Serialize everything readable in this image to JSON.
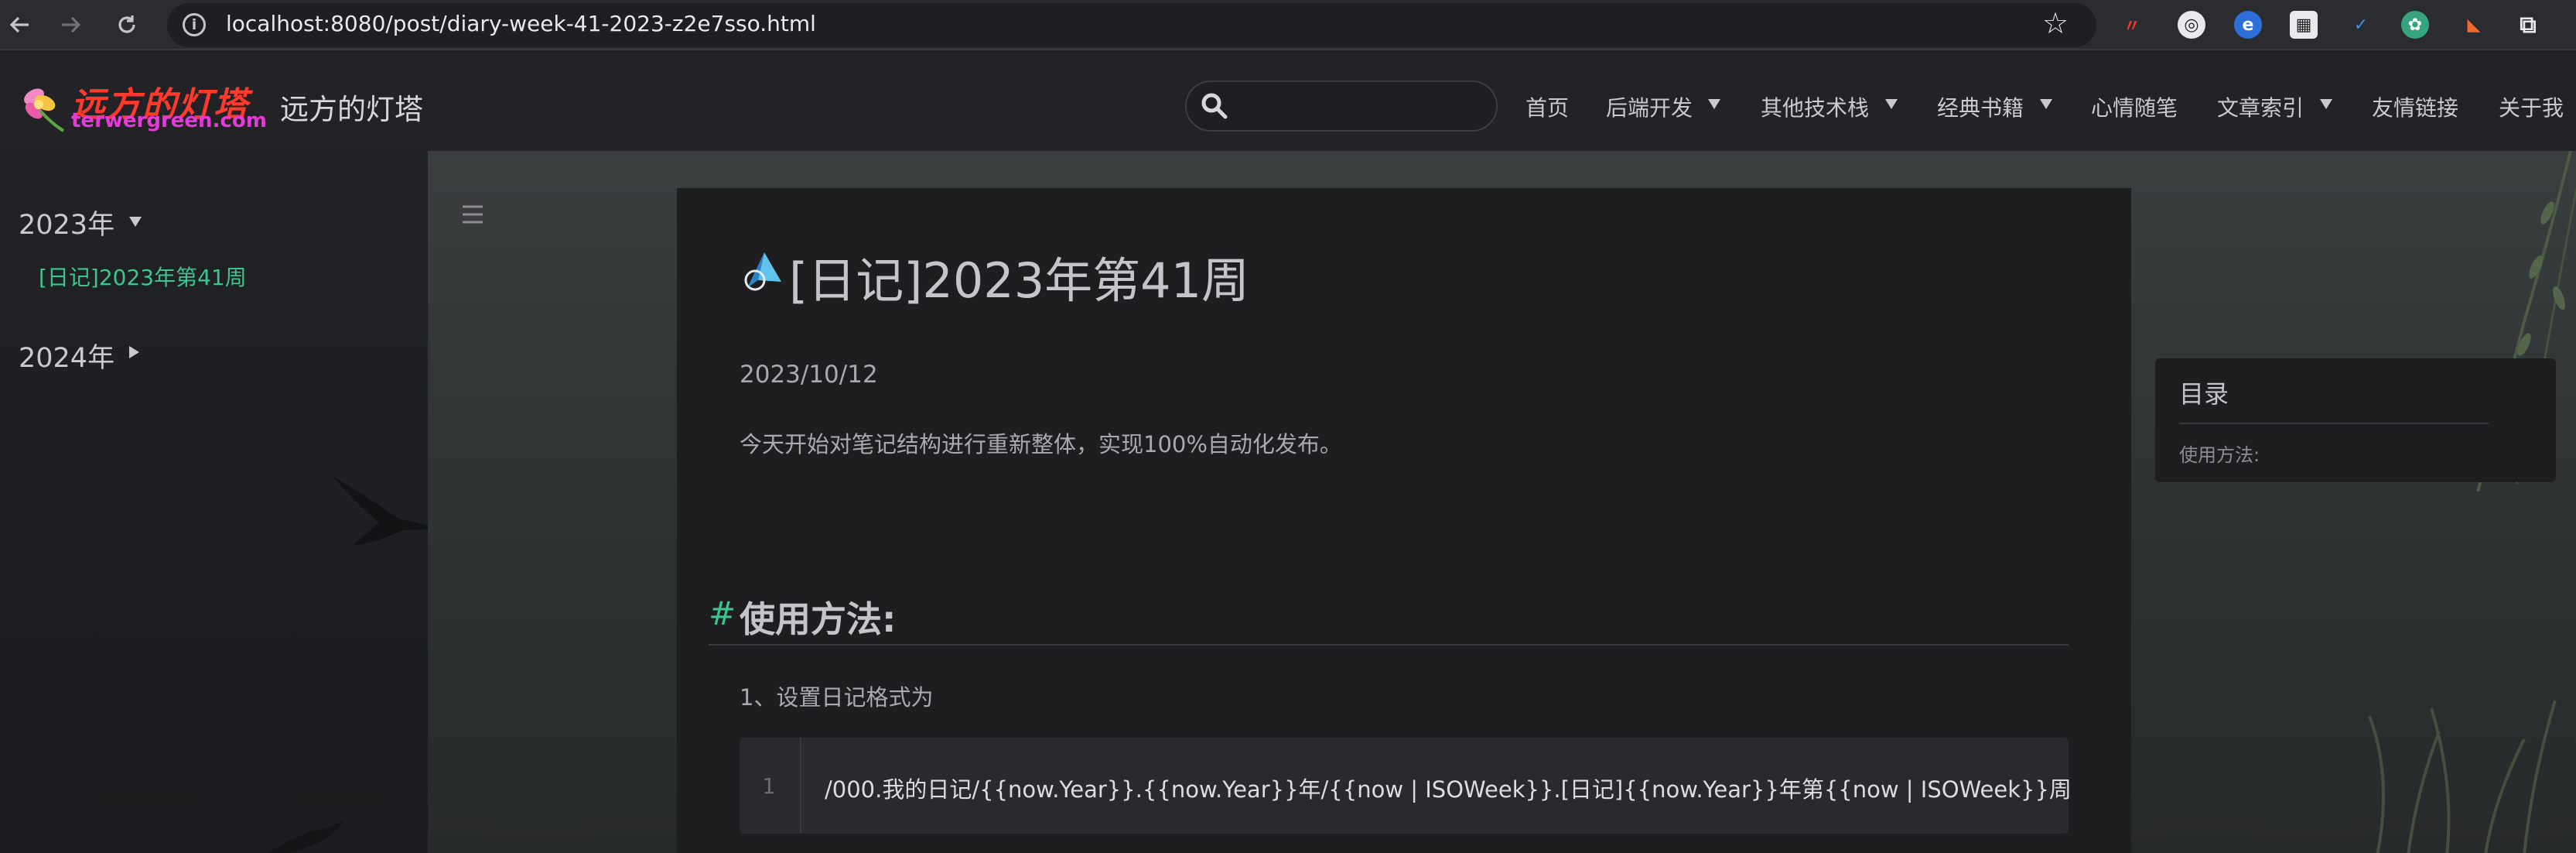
{
  "browser": {
    "url": "localhost:8080/post/diary-week-41-2023-z2e7sso.html",
    "back_icon": "arrow-left-icon",
    "forward_icon": "arrow-right-icon",
    "reload_icon": "reload-icon",
    "extension_icons": [
      "red-extension-icon",
      "reader-extension-icon",
      "blue-globe-extension-icon",
      "qr-code-extension-icon",
      "small-blue-extension-icon",
      "green-chatgpt-extension-icon",
      "orange-extension-icon",
      "puzzle-extensions-icon"
    ]
  },
  "site": {
    "logo_text": "远方的灯塔",
    "logo_domain": "terwergreen.com",
    "title": "远方的灯塔",
    "search_placeholder": "",
    "menu": [
      {
        "label": "首页",
        "has_dropdown": false
      },
      {
        "label": "后端开发",
        "has_dropdown": true
      },
      {
        "label": "其他技术栈",
        "has_dropdown": true
      },
      {
        "label": "经典书籍",
        "has_dropdown": true
      },
      {
        "label": "心情随笔",
        "has_dropdown": false
      },
      {
        "label": "文章索引",
        "has_dropdown": true
      },
      {
        "label": "友情链接",
        "has_dropdown": false
      },
      {
        "label": "关于我",
        "has_dropdown": false
      }
    ]
  },
  "sidebar": {
    "years": [
      {
        "label": "2023年",
        "expanded": true,
        "posts": [
          "[日记]2023年第41周"
        ]
      },
      {
        "label": "2024年",
        "expanded": false,
        "posts": []
      }
    ]
  },
  "article": {
    "title": "[日记]2023年第41周",
    "date": "2023/10/12",
    "intro": "今天开始对笔记结构进行重新整体，实现100%自动化发布。",
    "heading_hash": "#",
    "heading": "使用方法:",
    "step": "1、设置日记格式为",
    "code": {
      "line_number": "1",
      "text": "/000.我的日记/{{now.Year}}.{{now.Year}}年/{{now | ISOWeek}}.[日记]{{now.Year}}年第{{now | ISOWeek}}周"
    }
  },
  "toc": {
    "title": "目录",
    "items": [
      "使用方法:"
    ]
  },
  "colors": {
    "accent_green": "#3ec58e",
    "page_bg": "#202124",
    "card_bg": "#1e1e21"
  }
}
